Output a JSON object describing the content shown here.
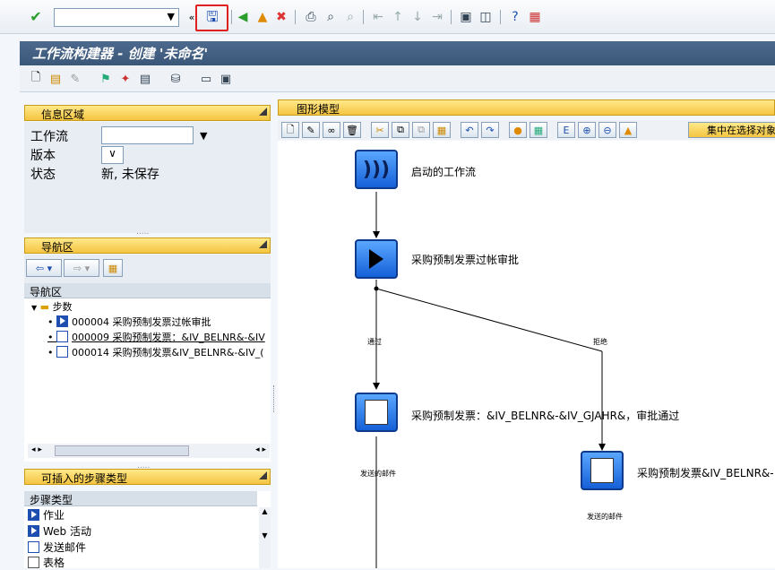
{
  "window": {
    "title": "工作流构建器 - 创建 '未命名'",
    "command_field_value": ""
  },
  "colors": {
    "title_bar": "#3f5c80",
    "panel_header": "#f4c542",
    "node_blue": "#1e6fe0",
    "highlight": "#e02020"
  },
  "left_panel": {
    "info_header": "信息区域",
    "workflow_label": "工作流",
    "workflow_value": "",
    "version_label": "版本",
    "version_value": "",
    "status_label": "状态",
    "status_value": "新, 未保存",
    "nav_header": "导航区",
    "nav_tree_header": "导航区",
    "tree_root": "步数",
    "tree_items": [
      "000004 采购预制发票过帐审批",
      "000009 采购预制发票：&IV_BELNR&-&IV",
      "000014 采购预制发票&IV_BELNR&-&IV_("
    ],
    "step_types_header": "可插入的步骤类型",
    "step_types_col": "步骤类型",
    "step_types": [
      "作业",
      "Web 活动",
      "发送邮件",
      "表格"
    ]
  },
  "graphic": {
    "header": "图形模型",
    "focus_button": "集中在选择对象",
    "nodes": [
      {
        "label": "启动的工作流"
      },
      {
        "label": "采购预制发票过帐审批"
      },
      {
        "label": "采购预制发票：&IV_BELNR&-&IV_GJAHR&，审批通过"
      },
      {
        "label": "采购预制发票&IV_BELNR&-"
      }
    ],
    "edge_labels": {
      "approve": "通过",
      "reject": "拒绝"
    },
    "mail_caption_1": "发送的邮件",
    "mail_caption_2": "发送的邮件"
  }
}
